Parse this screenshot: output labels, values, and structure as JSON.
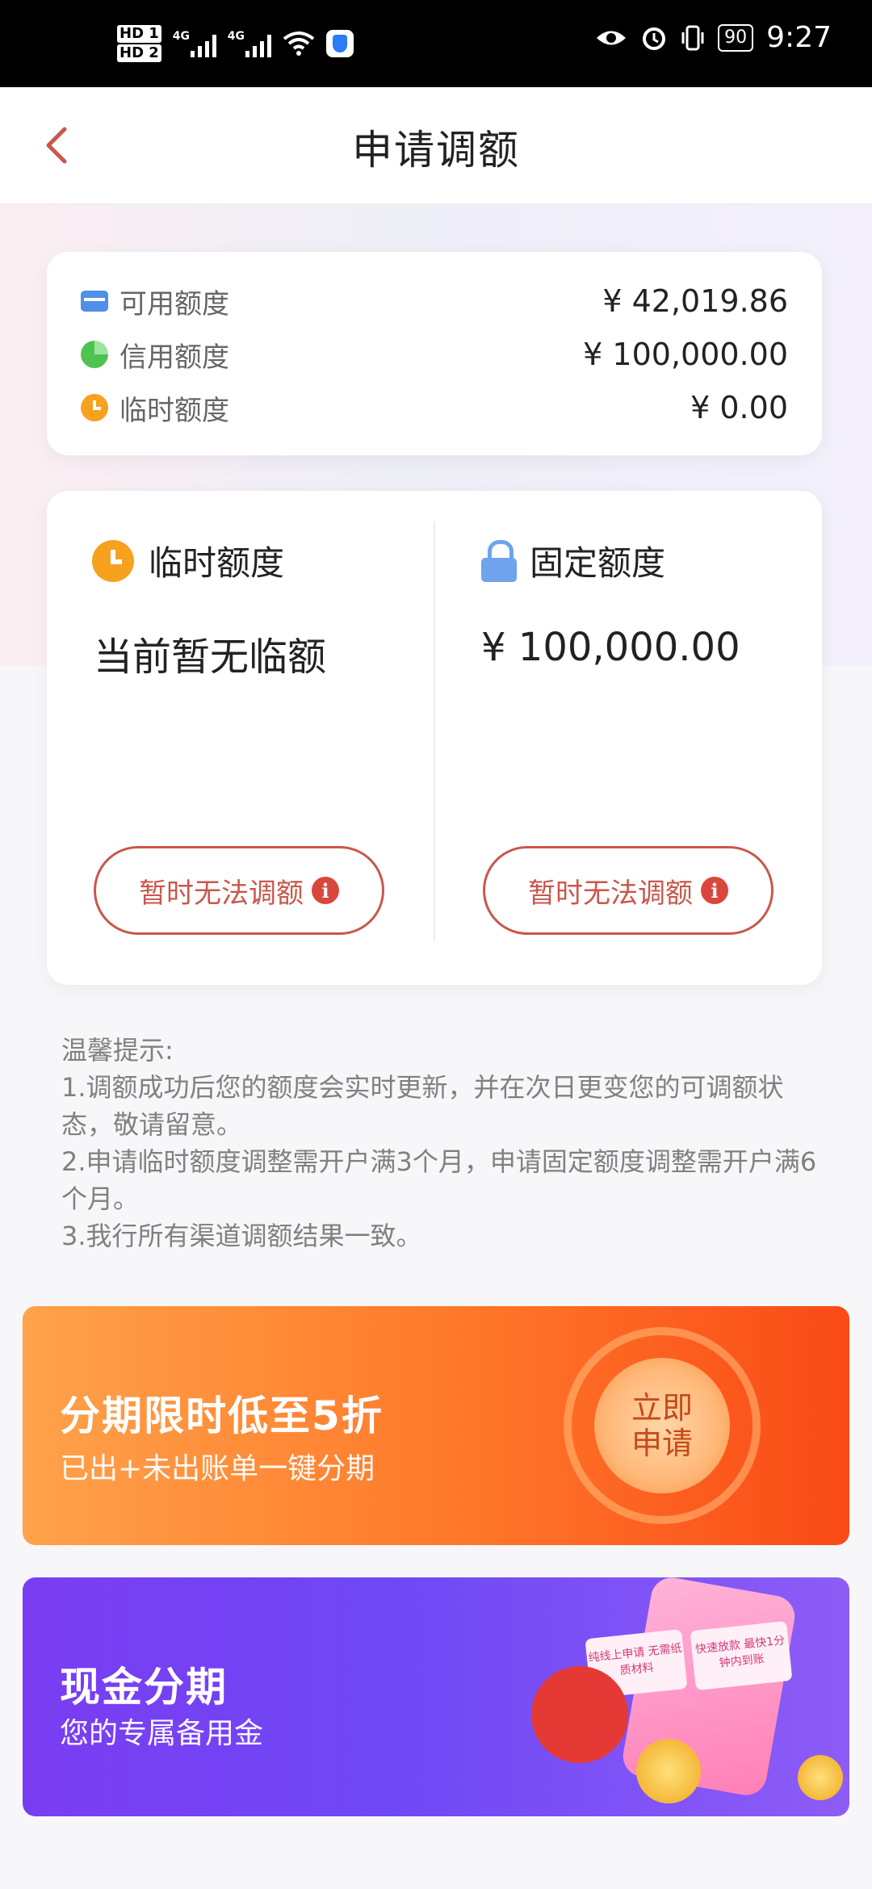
{
  "status_bar": {
    "sim1": "HD 1",
    "sim2": "HD 2",
    "network1": "4G",
    "network2": "4G",
    "battery": "90",
    "time": "9:27",
    "icons": [
      "eye-icon",
      "alarm-icon",
      "vibrate-icon",
      "wifi-icon",
      "shield-icon"
    ]
  },
  "header": {
    "title": "申请调额",
    "back_icon": "chevron-left-icon",
    "accent_color": "#c9574c"
  },
  "summary": {
    "rows": [
      {
        "icon": "card-icon",
        "label": "可用额度",
        "value": "¥ 42,019.86"
      },
      {
        "icon": "pie-icon",
        "label": "信用额度",
        "value": "¥ 100,000.00"
      },
      {
        "icon": "clock-icon",
        "label": "临时额度",
        "value": "¥ 0.00"
      }
    ]
  },
  "adjust": {
    "temp": {
      "icon": "clock-icon",
      "title": "临时额度",
      "value": "当前暂无临额",
      "button": "暂时无法调额"
    },
    "fixed": {
      "icon": "lock-icon",
      "title": "固定额度",
      "value": "¥ 100,000.00",
      "button": "暂时无法调额"
    }
  },
  "tips": {
    "heading": "温馨提示:",
    "lines": [
      "1.调额成功后您的额度会实时更新，并在次日更变您的可调额状态，敬请留意。",
      "2.申请临时额度调整需开户满3个月，申请固定额度调整需开户满6个月。",
      "3.我行所有渠道调额结果一致。"
    ]
  },
  "banners": {
    "installment": {
      "title": "分期限时低至5折",
      "subtitle": "已出+未出账单一键分期",
      "cta": "立即申请"
    },
    "cash": {
      "title": "现金分期",
      "subtitle": "您的专属备用金",
      "tag1": "纯线上申请 无需纸质材料",
      "tag2": "快速放款 最快1分钟内到账"
    }
  }
}
